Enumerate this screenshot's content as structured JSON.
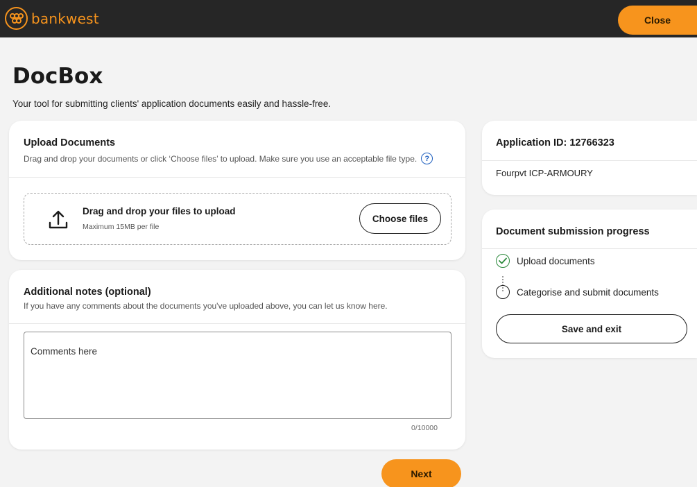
{
  "header": {
    "brand": "bankwest",
    "close_label": "Close"
  },
  "page": {
    "title": "DocBox",
    "subtitle": "Your tool for submitting clients' application documents easily and hassle-free."
  },
  "upload": {
    "title": "Upload Documents",
    "description": "Drag and drop your documents or click ‘Choose files’ to upload. Make sure you use an acceptable file type.",
    "help_glyph": "?",
    "drop_title": "Drag and drop your files to upload",
    "drop_sub": "Maximum 15MB per file",
    "choose_label": "Choose files"
  },
  "notes": {
    "title": "Additional notes (optional)",
    "description": "If you have any comments about the documents you've uploaded above, you can let us know here.",
    "placeholder": "Comments here",
    "counter": "0/10000"
  },
  "application": {
    "id_label": "Application ID: 12766323",
    "name": "Fourpvt ICP-ARMOURY"
  },
  "progress": {
    "title": "Document submission progress",
    "steps": [
      {
        "label": "Upload documents",
        "status": "done"
      },
      {
        "label": "Categorise and submit documents",
        "status": "todo"
      }
    ],
    "save_label": "Save and exit"
  },
  "footer": {
    "next_label": "Next"
  },
  "colors": {
    "brand_orange": "#f7941d",
    "topbar": "#262626",
    "success_green": "#2c8a3c",
    "help_blue": "#1e5fbf"
  }
}
